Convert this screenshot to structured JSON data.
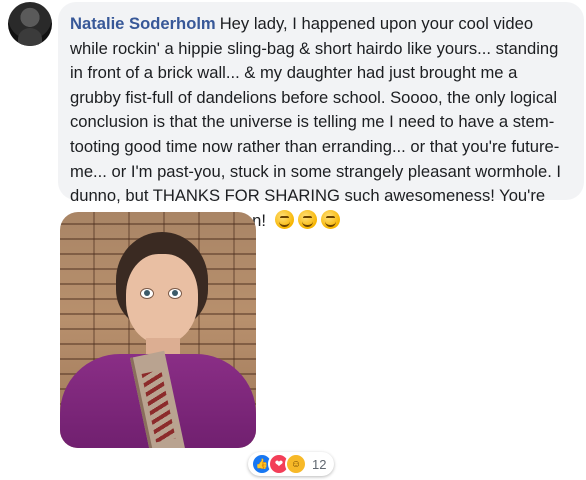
{
  "comment": {
    "author": "Natalie Soderholm",
    "text": "Hey lady, I happened upon your cool video while rockin' a hippie sling-bag & short hairdo like yours... standing in front of a brick wall... & my daughter had just brought me a grubby fist-full of dandelions before school. Soooo, the only logical conclusion is that the universe is telling me I need to have a stem-tooting good time now rather than erranding... or that you're future-me... or I'm past-you, stuck in some strangely pleasant wormhole. I dunno, but THANKS FOR SHARING such awesomeness! You're just dandy -- & I'm not lion!",
    "emojis": [
      "smile-emoji",
      "laughing-emoji",
      "wink-emoji"
    ]
  },
  "reactions": {
    "icons": [
      "like-icon",
      "love-icon",
      "haha-icon"
    ],
    "count": "12"
  }
}
